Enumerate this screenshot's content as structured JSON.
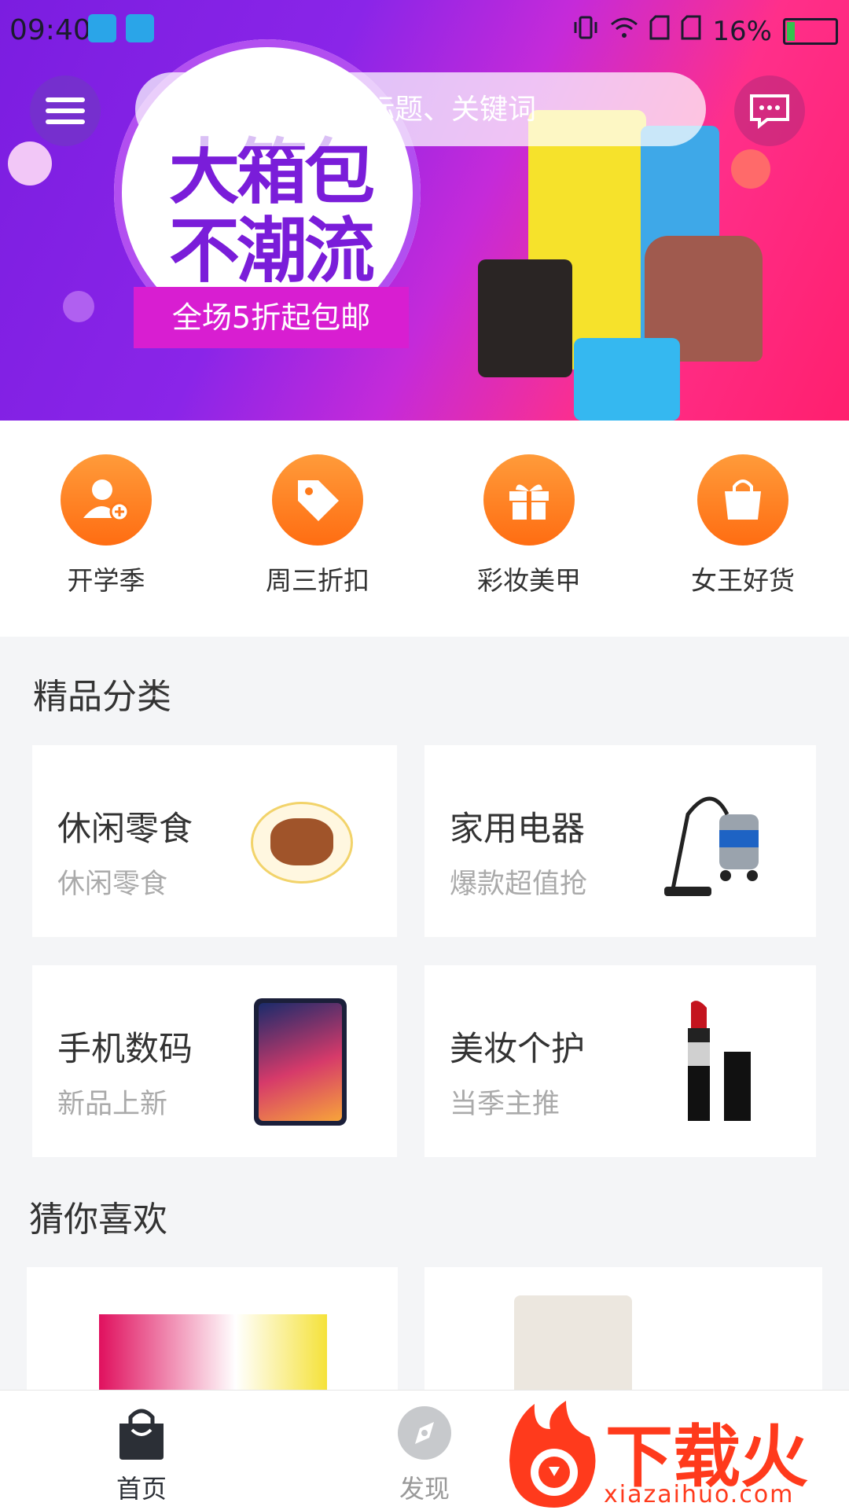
{
  "status_bar": {
    "time": "09:40",
    "battery": "16%"
  },
  "search": {
    "placeholder": "请输入商品标题、关键词"
  },
  "banner": {
    "headline_line1": "大箱包",
    "headline_line2": "不潮流",
    "ribbon": "全场5折起包邮"
  },
  "quick_entries": [
    {
      "label": "开学季",
      "icon": "add-user-icon"
    },
    {
      "label": "周三折扣",
      "icon": "price-tag-icon"
    },
    {
      "label": "彩妆美甲",
      "icon": "gift-icon"
    },
    {
      "label": "女王好货",
      "icon": "shopping-bag-icon"
    }
  ],
  "categories_section": {
    "title": "精品分类",
    "items": [
      {
        "title": "休闲零食",
        "subtitle": "休闲零食",
        "image": "snack-image"
      },
      {
        "title": "家用电器",
        "subtitle": "爆款超值抢",
        "image": "vacuum-cleaner-image"
      },
      {
        "title": "手机数码",
        "subtitle": "新品上新",
        "image": "smartphone-image"
      },
      {
        "title": "美妆个护",
        "subtitle": "当季主推",
        "image": "lipstick-image"
      }
    ]
  },
  "recommend_section": {
    "title": "猜你喜欢"
  },
  "tabbar": {
    "home": "首页",
    "discover": "发现"
  },
  "watermark": {
    "text": "下载火",
    "url": "xiazaihuo.com"
  },
  "colors": {
    "accent": "#ff7a1a",
    "banner_purple": "#7b1de0",
    "banner_pink": "#ff1f6e"
  }
}
